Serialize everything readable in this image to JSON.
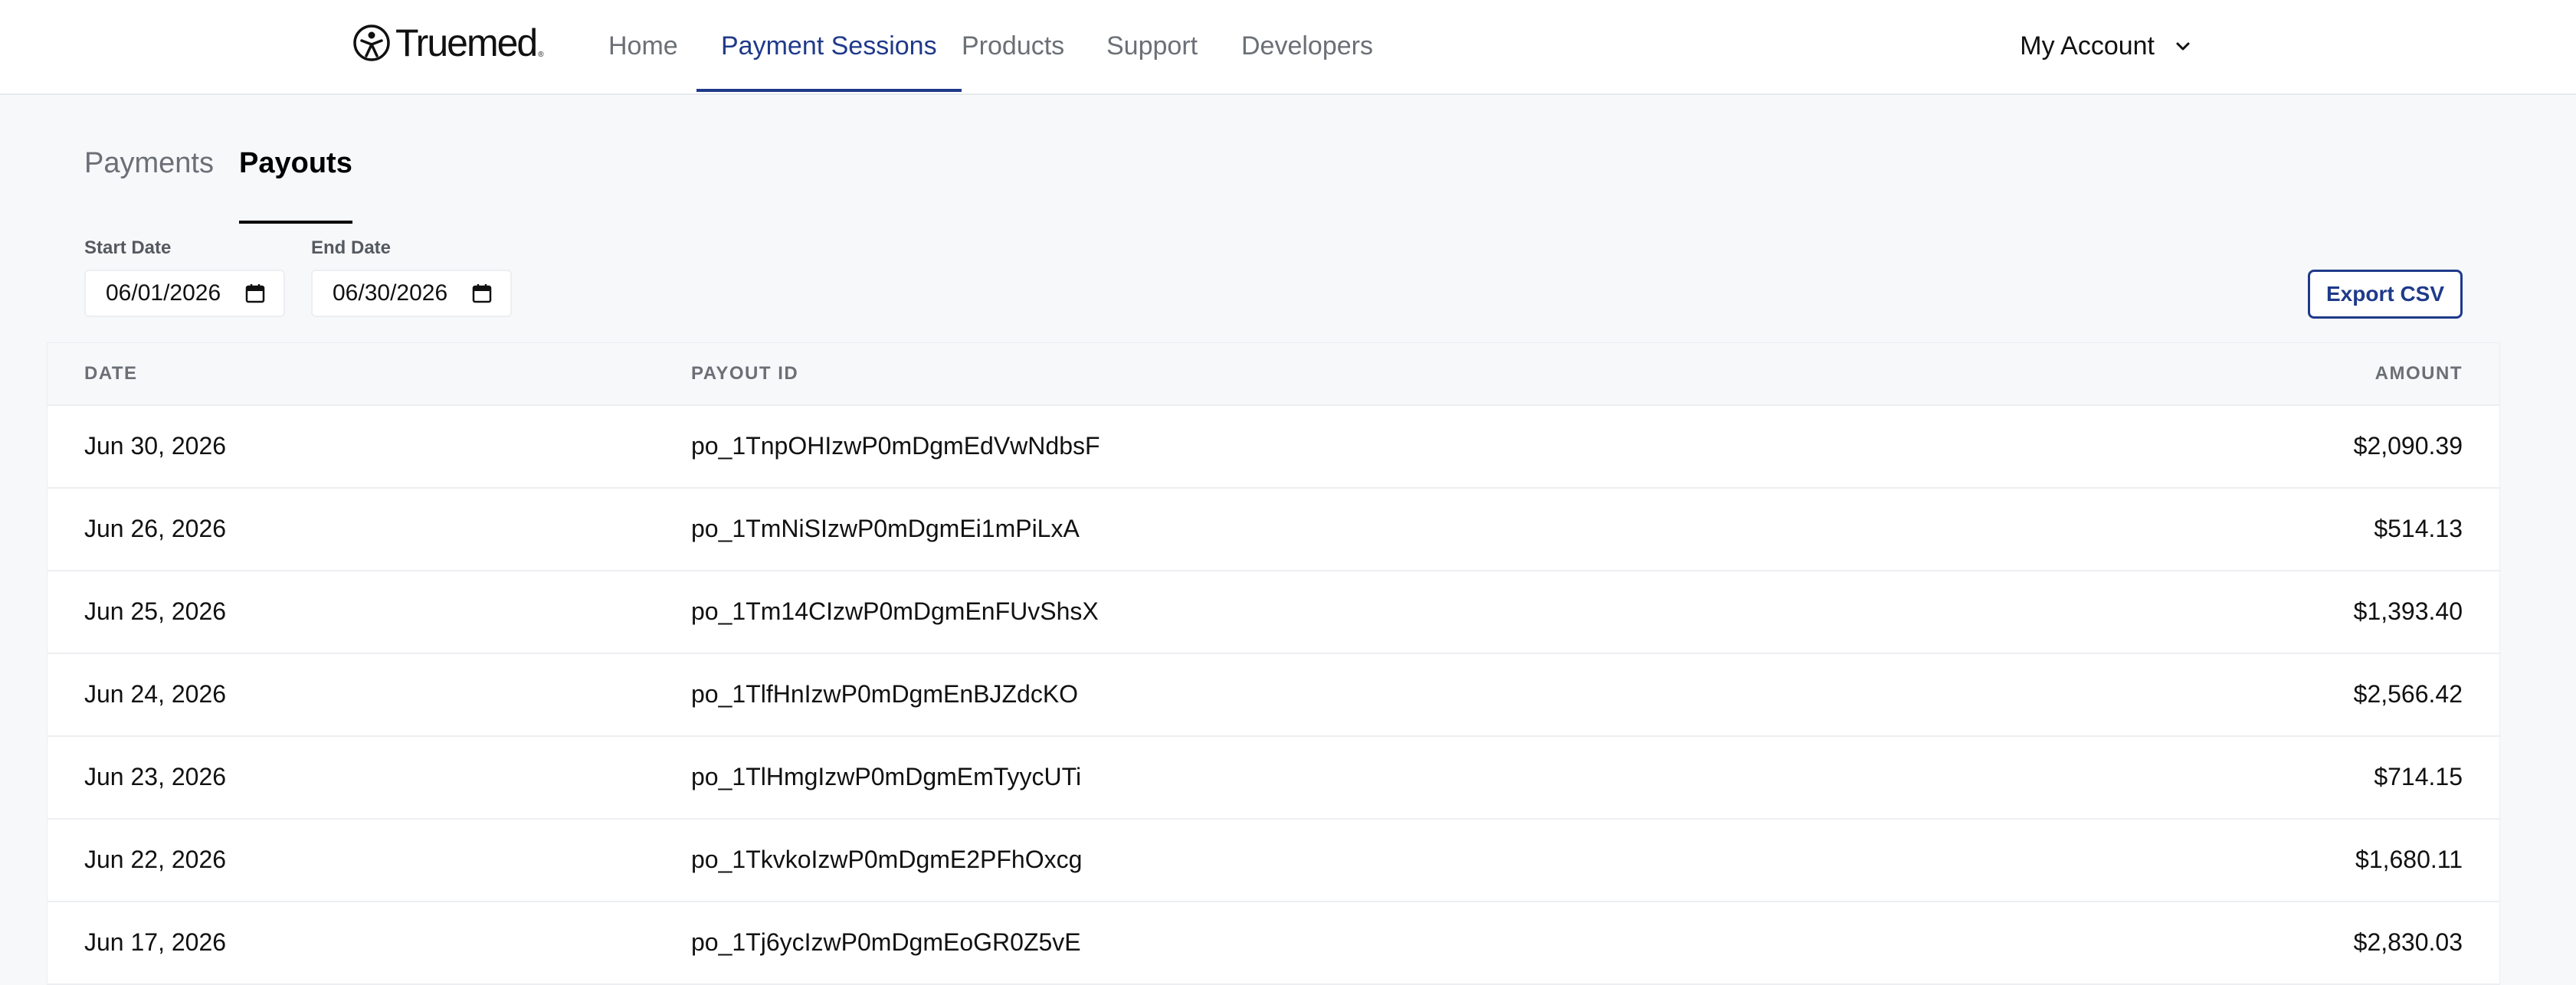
{
  "brand": {
    "name": "Truemed",
    "trademark": "®"
  },
  "nav": {
    "items": [
      {
        "label": "Home",
        "active": false
      },
      {
        "label": "Payment Sessions",
        "active": true
      },
      {
        "label": "Products",
        "active": false
      },
      {
        "label": "Support",
        "active": false
      },
      {
        "label": "Developers",
        "active": false
      }
    ],
    "account_label": "My Account"
  },
  "subtabs": [
    {
      "label": "Payments",
      "active": false
    },
    {
      "label": "Payouts",
      "active": true
    }
  ],
  "filters": {
    "start_label": "Start Date",
    "start_value": "06/01/2026",
    "end_label": "End Date",
    "end_value": "06/30/2026",
    "export_label": "Export CSV"
  },
  "table": {
    "columns": [
      "DATE",
      "PAYOUT ID",
      "AMOUNT"
    ],
    "rows": [
      {
        "date": "Jun 30, 2026",
        "payout_id": "po_1TnpOHIzwP0mDgmEdVwNdbsF",
        "amount": "$2,090.39"
      },
      {
        "date": "Jun 26, 2026",
        "payout_id": "po_1TmNiSIzwP0mDgmEi1mPiLxA",
        "amount": "$514.13"
      },
      {
        "date": "Jun 25, 2026",
        "payout_id": "po_1Tm14CIzwP0mDgmEnFUvShsX",
        "amount": "$1,393.40"
      },
      {
        "date": "Jun 24, 2026",
        "payout_id": "po_1TlfHnIzwP0mDgmEnBJZdcKO",
        "amount": "$2,566.42"
      },
      {
        "date": "Jun 23, 2026",
        "payout_id": "po_1TlHmgIzwP0mDgmEmTyycUTi",
        "amount": "$714.15"
      },
      {
        "date": "Jun 22, 2026",
        "payout_id": "po_1TkvkoIzwP0mDgmE2PFhOxcg",
        "amount": "$1,680.11"
      },
      {
        "date": "Jun 17, 2026",
        "payout_id": "po_1Tj6ycIzwP0mDgmEoGR0Z5vE",
        "amount": "$2,830.03"
      }
    ]
  },
  "icons": {
    "logo": "person-circle-icon",
    "account": "chevron-down-icon",
    "date": "calendar-icon"
  },
  "colors": {
    "accent": "#1f3a8a",
    "page_bg": "#f7f8fa",
    "muted_text": "#6b6f76"
  }
}
